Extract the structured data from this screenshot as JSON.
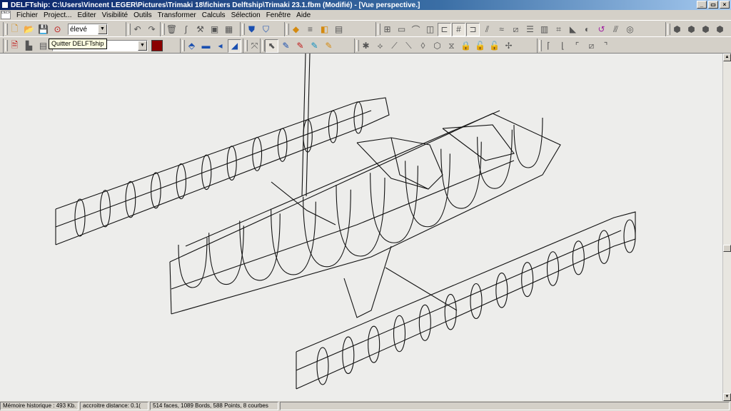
{
  "window": {
    "title": "DELFTship: C:\\Users\\Vincent LEGER\\Pictures\\Trimaki 18\\fichiers Delftship\\Trimaki 23.1.fbm (Modifié) - [Vue  perspective.]",
    "logo_text": "DELFTship",
    "controls": {
      "minimize": "_",
      "maximize": "□",
      "close": "×",
      "restore": "▭"
    }
  },
  "menu": {
    "items": [
      "Fichier",
      "Project...",
      "Editer",
      "Visibilité",
      "Outils",
      "Transformer",
      "Calculs",
      "Sélection",
      "Fenêtre",
      "Aide"
    ]
  },
  "toolbar": {
    "layer_combo_value": "élevé",
    "layer_select_value": "",
    "tooltip": "Quitter DELFTship",
    "layer_color": "#8b0000"
  },
  "icons": {
    "new": "new-file-icon",
    "open": "open-folder-icon",
    "save": "save-disk-icon",
    "exit": "exit-icon",
    "undo": "undo-icon",
    "redo": "redo-icon"
  },
  "statusbar": {
    "undo_memory": "Mémoire historique : 493 Kb.",
    "distance": "accroitre distance: 0.1(",
    "model_info": "514 faces, 1089 Bords, 588 Points, 8 courbes"
  },
  "colors": {
    "window_bg": "#d4d0c8",
    "viewport_bg": "#ededeb",
    "wireframe": "#111111"
  }
}
